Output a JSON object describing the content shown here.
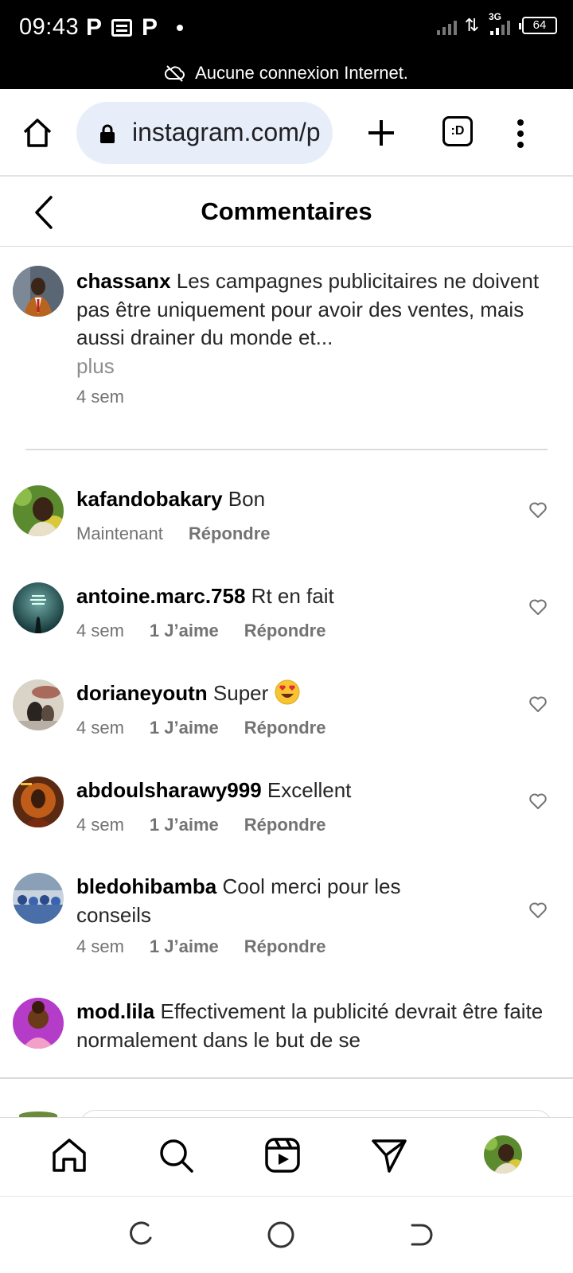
{
  "status_bar": {
    "time": "09:43",
    "network": "3G",
    "battery": "64",
    "offline_message": "Aucune connexion Internet."
  },
  "browser": {
    "url": "instagram.com/p",
    "tabs_label": ":D"
  },
  "header": {
    "title": "Commentaires"
  },
  "caption": {
    "username": "chassanx",
    "text": "Les campagnes publicitaires ne doivent pas être uniquement pour avoir des ventes, mais aussi drainer du monde et...",
    "more_label": "plus",
    "time": "4 sem"
  },
  "comments": [
    {
      "username": "kafandobakary",
      "text": "Bon",
      "time": "Maintenant",
      "likes": "",
      "reply": "Répondre"
    },
    {
      "username": "antoine.marc.758",
      "text": "Rt en fait",
      "time": "4 sem",
      "likes": "1 J’aime",
      "reply": "Répondre"
    },
    {
      "username": "dorianeyoutn",
      "text": "Super",
      "time": "4 sem",
      "likes": "1 J’aime",
      "reply": "Répondre"
    },
    {
      "username": "abdoulsharawy999",
      "text": "Excellent",
      "time": "4 sem",
      "likes": "1 J’aime",
      "reply": "Répondre"
    },
    {
      "username": "bledohibamba",
      "text": "Cool merci pour les conseils",
      "time": "4 sem",
      "likes": "1 J’aime",
      "reply": "Répondre"
    },
    {
      "username": "mod.lila",
      "text": "Effectivement la publicité devrait être faite normalement dans le but de se",
      "time": "",
      "likes": "",
      "reply": ""
    }
  ],
  "icons": {
    "home": "home-icon",
    "search": "search-icon",
    "reels": "reels-icon",
    "direct": "paper-plane-icon",
    "heart": "heart-outline-icon"
  }
}
